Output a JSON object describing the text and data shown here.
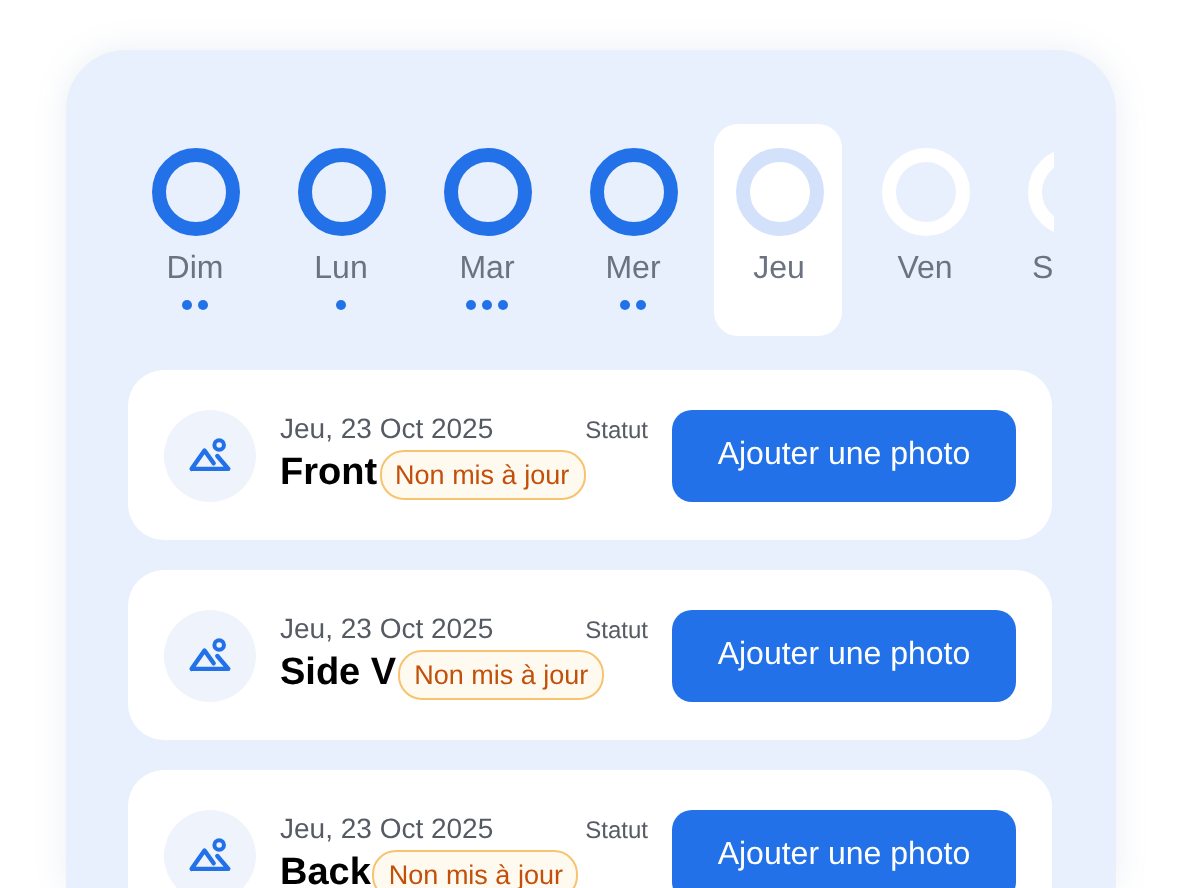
{
  "days": [
    {
      "label": "Dim",
      "complete": true,
      "selected": false,
      "markers": [
        {
          "kind": "dot"
        },
        {
          "kind": "dot"
        }
      ]
    },
    {
      "label": "Lun",
      "complete": true,
      "selected": false,
      "markers": [
        {
          "kind": "dot"
        }
      ]
    },
    {
      "label": "Mar",
      "complete": true,
      "selected": false,
      "markers": [
        {
          "kind": "dot"
        },
        {
          "kind": "dot"
        },
        {
          "kind": "dot"
        }
      ]
    },
    {
      "label": "Mer",
      "complete": true,
      "selected": false,
      "markers": [
        {
          "kind": "dot"
        },
        {
          "kind": "dot"
        }
      ]
    },
    {
      "label": "Jeu",
      "complete": false,
      "selected": true
    },
    {
      "label": "Ven",
      "complete": false,
      "selected": false
    },
    {
      "label": "S",
      "complete": false,
      "selected": false
    }
  ],
  "photos": [
    {
      "date": "Jeu, 23 Oct 2025",
      "status_label": "Statut",
      "title": "Front",
      "badge": "Non mis à jour",
      "button": "Ajouter une photo"
    },
    {
      "date": "Jeu, 23 Oct 2025",
      "status_label": "Statut",
      "title": "Side V",
      "badge": "Non mis à jour",
      "button": "Ajouter une photo"
    },
    {
      "date": "Jeu, 23 Oct 2025",
      "status_label": "Statut",
      "title": "Back",
      "badge": "Non mis à jour",
      "button": "Ajouter une photo"
    }
  ]
}
